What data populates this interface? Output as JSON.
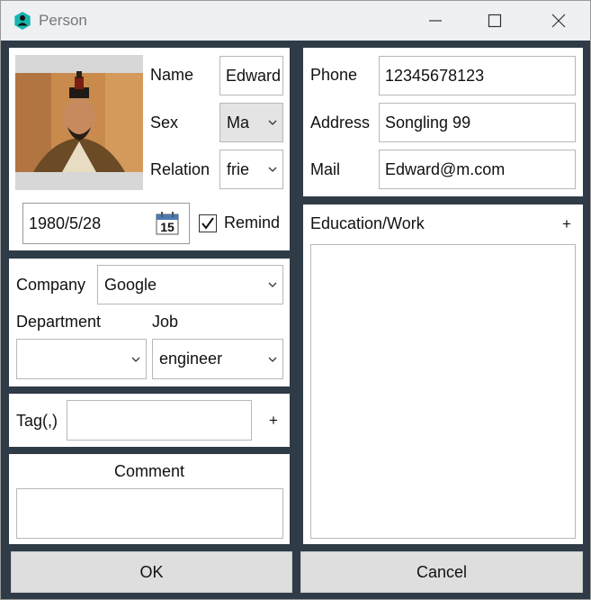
{
  "window": {
    "title": "Person"
  },
  "basic": {
    "name_label": "Name",
    "name_value": "Edward",
    "sex_label": "Sex",
    "sex_value": "Ma",
    "relation_label": "Relation",
    "relation_value": "frie",
    "birthday": "1980/5/28",
    "calendar_day": "15",
    "remind_label": "Remind",
    "remind_checked": true
  },
  "contact": {
    "phone_label": "Phone",
    "phone_value": "12345678123",
    "address_label": "Address",
    "address_value": "Songling 99",
    "mail_label": "Mail",
    "mail_value": "Edward@m.com"
  },
  "work": {
    "company_label": "Company",
    "company_value": "Google",
    "department_label": "Department",
    "department_value": "",
    "job_label": "Job",
    "job_value": "engineer"
  },
  "tag": {
    "label": "Tag(,)",
    "value": "",
    "add": "+"
  },
  "comment": {
    "label": "Comment",
    "value": ""
  },
  "education": {
    "label": "Education/Work",
    "add": "+"
  },
  "buttons": {
    "ok": "OK",
    "cancel": "Cancel"
  },
  "colors": {
    "frame": "#2f3b46",
    "icon_teal": "#17b6b0",
    "button_bg": "#dedede"
  }
}
